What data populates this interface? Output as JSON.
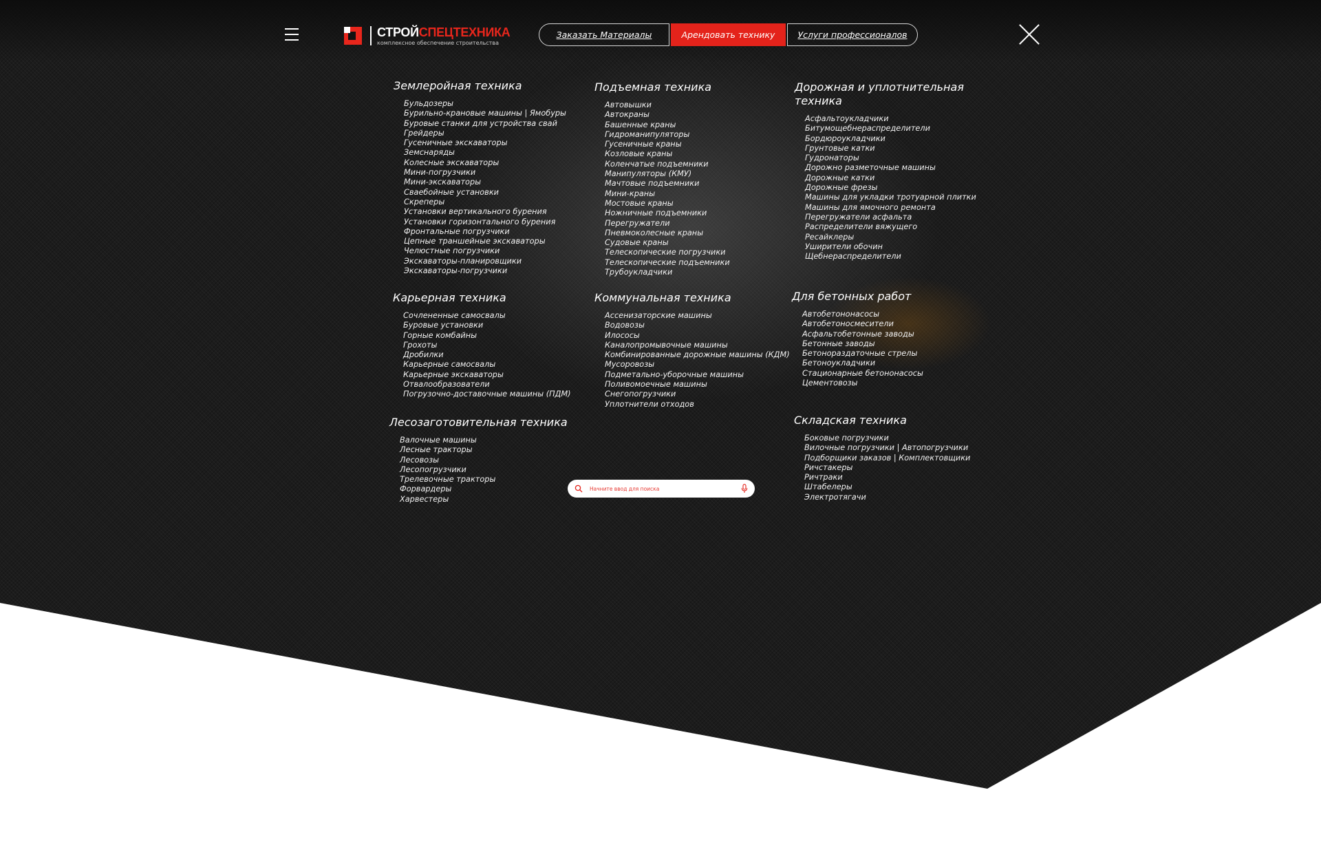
{
  "header": {
    "logo": {
      "name_white": "СТРОЙ",
      "name_red": "СПЕЦТЕХНИКА",
      "subtitle": "комплексное обеспечение строительства"
    },
    "nav": [
      "Заказать Материалы",
      "Арендовать технику",
      "Услуги профессионалов"
    ]
  },
  "search": {
    "placeholder": "Начните ввод для поиска"
  },
  "icons": {
    "menu": "hamburger-menu-icon",
    "close": "close-icon",
    "search": "search-icon",
    "mic": "microphone-icon"
  },
  "colors": {
    "accent": "#e4231b",
    "background": "#1c1c1c",
    "text": "#ffffff"
  },
  "categories": [
    {
      "title": "Землеройная техника",
      "items": [
        "Бульдозеры",
        "Бурильно-крановые машины | Ямобуры",
        "Буровые станки для устройства свай",
        "Грейдеры",
        "Гусеничные экскаваторы",
        "Земснаряды",
        "Колесные экскаваторы",
        "Мини-погрузчики",
        "Мини-экскаваторы",
        "Сваебойные установки",
        "Скреперы",
        "Установки вертикального бурения",
        "Установки горизонтального бурения",
        "Фронтальные погрузчики",
        "Цепные траншейные экскаваторы",
        "Челюстные погрузчики",
        "Экскаваторы-планировщики",
        "Экскаваторы-погрузчики"
      ]
    },
    {
      "title": "Подъемная техника",
      "items": [
        "Автовышки",
        "Автокраны",
        "Башенные краны",
        "Гидроманипуляторы",
        "Гусеничные краны",
        "Козловые краны",
        "Коленчатые подъемники",
        "Манипуляторы (КМУ)",
        "Мачтовые подъемники",
        "Мини-краны",
        "Мостовые краны",
        "Ножничные подъемники",
        "Перегружатели",
        "Пневмоколесные краны",
        "Судовые краны",
        "Телескопические погрузчики",
        "Телескопические подъемники",
        "Трубоукладчики"
      ]
    },
    {
      "title": "Дорожная и уплотнительная техника",
      "items": [
        "Асфальтоукладчики",
        "Битумощебнераспределители",
        "Бордюроукладчики",
        "Грунтовые катки",
        "Гудронаторы",
        "Дорожно разметочные машины",
        "Дорожные катки",
        "Дорожные фрезы",
        "Машины для укладки тротуарной плитки",
        "Машины для ямочного ремонта",
        "Перегружатели асфальта",
        "Распределители вяжущего",
        "Ресайклеры",
        "Уширители обочин",
        "Щебнераспределители"
      ]
    },
    {
      "title": "Карьерная техника",
      "items": [
        "Сочлененные самосвалы",
        "Буровые установки",
        "Горные комбайны",
        "Грохоты",
        "Дробилки",
        "Карьерные самосвалы",
        "Карьерные экскаваторы",
        "Отвалообразователи",
        "Погрузочно-доставочные машины (ПДМ)"
      ]
    },
    {
      "title": "Коммунальная техника",
      "items": [
        "Ассенизаторские машины",
        "Водовозы",
        "Илососы",
        "Каналопромывочные машины",
        "Комбинированные дорожные машины (КДМ)",
        "Мусоровозы",
        "Подметально-уборочные машины",
        "Поливомоечные машины",
        "Снегопогрузчики",
        "Уплотнители отходов"
      ]
    },
    {
      "title": "Для бетонных работ",
      "items": [
        "Автобетононасосы",
        "Автобетоносмесители",
        "Асфальтобетонные заводы",
        "Бетонные заводы",
        "Бетонораздаточные стрелы",
        "Бетоноукладчики",
        "Стационарные бетононасосы",
        "Цементовозы"
      ]
    },
    {
      "title": "Лесозаготовительная техника",
      "items": [
        "Валочные машины",
        "Лесные тракторы",
        "Лесовозы",
        "Лесопогрузчики",
        "Трелевочные тракторы",
        "Форвардеры",
        "Харвестеры"
      ]
    },
    {
      "title": "Складская техника",
      "items": [
        "Боковые погрузчики",
        "Вилочные погрузчики | Автопогрузчики",
        "Подборщики заказов | Комплектовщики",
        "Ричстакеры",
        "Ричтраки",
        "Штабелеры",
        "Электротягачи"
      ]
    }
  ]
}
